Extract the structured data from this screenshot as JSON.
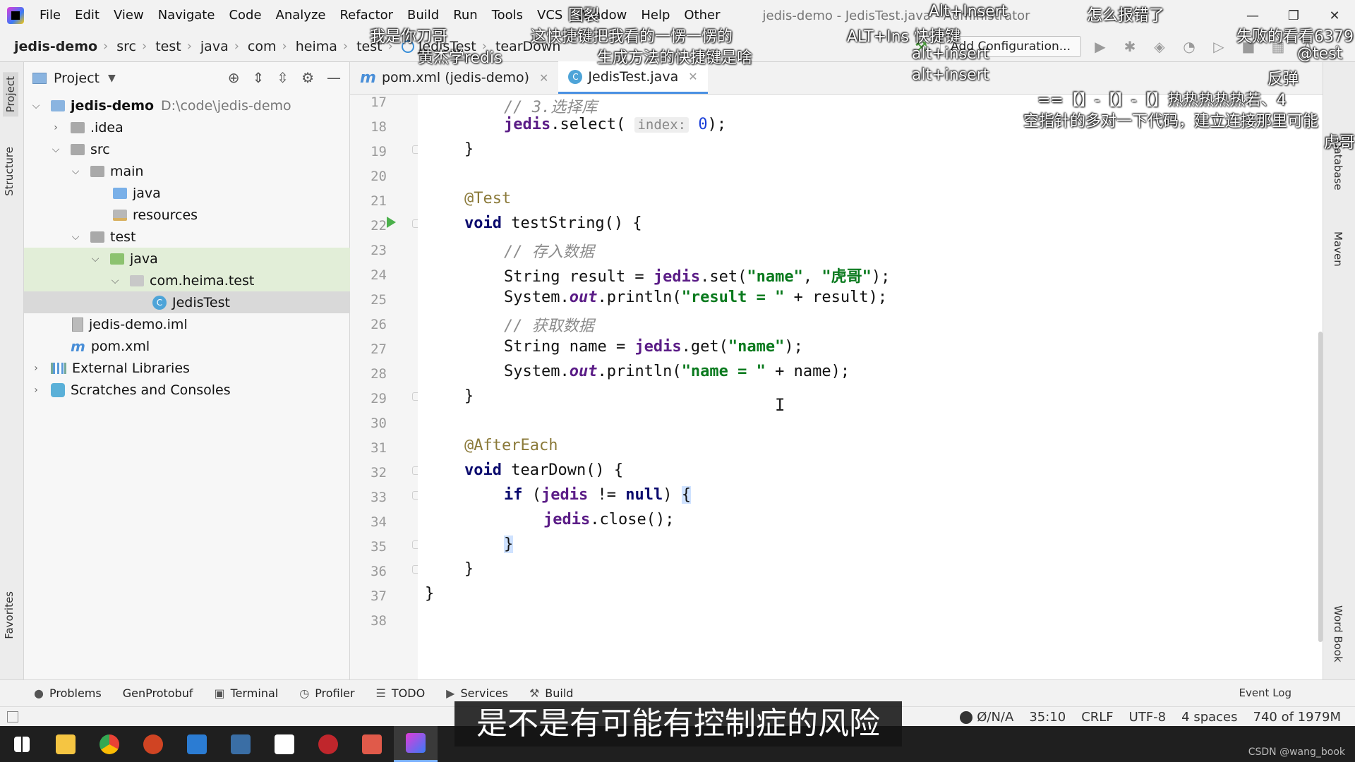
{
  "menubar": {
    "items": [
      "File",
      "Edit",
      "View",
      "Navigate",
      "Code",
      "Analyze",
      "Refactor",
      "Build",
      "Run",
      "Tools",
      "VCS",
      "Window",
      "Help",
      "Other"
    ],
    "title": "jedis-demo - JedisTest.java - Administrator"
  },
  "breadcrumb": {
    "items": [
      "jedis-demo",
      "src",
      "test",
      "java",
      "com",
      "heima",
      "test",
      "JedisTest",
      "tearDown"
    ]
  },
  "toolbar": {
    "add_configuration": "Add Configuration..."
  },
  "left_strip": {
    "project": "Project",
    "structure": "Structure",
    "favorites": "Favorites"
  },
  "project_panel": {
    "title": "Project",
    "root_name": "jedis-demo",
    "root_path": "D:\\code\\jedis-demo",
    "items": {
      "idea": ".idea",
      "src": "src",
      "main": "main",
      "main_java": "java",
      "resources": "resources",
      "test": "test",
      "test_java": "java",
      "package": "com.heima.test",
      "jedistest": "JedisTest",
      "iml": "jedis-demo.iml",
      "pom": "pom.xml",
      "external": "External Libraries",
      "scratches": "Scratches and Consoles"
    }
  },
  "editor": {
    "tabs": [
      {
        "label": "pom.xml (jedis-demo)",
        "active": false
      },
      {
        "label": "JedisTest.java",
        "active": true
      }
    ],
    "line_numbers": [
      "17",
      "18",
      "19",
      "20",
      "21",
      "22",
      "23",
      "24",
      "25",
      "26",
      "27",
      "28",
      "29",
      "30",
      "31",
      "32",
      "33",
      "34",
      "35",
      "36",
      "37",
      "38"
    ],
    "code": {
      "l17_comment": "// 3.选择库",
      "l18_obj": "jedis",
      "l18_call": ".select(",
      "l18_hint": "index:",
      "l18_num": "0",
      "l18_end": ");",
      "l19": "}",
      "l21": "@Test",
      "l22_kw": "void",
      "l22_rest": " testString() {",
      "l23": "// 存入数据",
      "l24_a": "String result = ",
      "l24_obj": "jedis",
      "l24_b": ".set(",
      "l24_s1": "\"name\"",
      "l24_c": ", ",
      "l24_s2": "\"虎哥\"",
      "l24_d": ");",
      "l25_a": "System.",
      "l25_out": "out",
      "l25_b": ".println(",
      "l25_s": "\"result = \"",
      "l25_c": " + result);",
      "l26": "// 获取数据",
      "l27_a": "String name = ",
      "l27_obj": "jedis",
      "l27_b": ".get(",
      "l27_s": "\"name\"",
      "l27_c": ");",
      "l28_a": "System.",
      "l28_out": "out",
      "l28_b": ".println(",
      "l28_s": "\"name = \"",
      "l28_c": " + name);",
      "l29": "}",
      "l31": "@AfterEach",
      "l32_kw": "void",
      "l32_rest": " tearDown() {",
      "l33_kw": "if",
      "l33_a": " (",
      "l33_obj": "jedis",
      "l33_b": " != ",
      "l33_null": "null",
      "l33_c": ") ",
      "l33_brace": "{",
      "l34_obj": "jedis",
      "l34_rest": ".close();",
      "l35": "}",
      "l36": "}",
      "l37": "}"
    }
  },
  "right_strip": {
    "database": "Database",
    "maven": "Maven",
    "wordbook": "Word Book"
  },
  "bottom_tools": [
    "Problems",
    "GenProtobuf",
    "Terminal",
    "Profiler",
    "TODO",
    "Services",
    "Build"
  ],
  "event_log": "Event Log",
  "status": {
    "vcs": "Ø/N/A",
    "position": "35:10",
    "line_sep": "CRLF",
    "encoding": "UTF-8",
    "indent": "4 spaces",
    "memory": "740 of 1979M"
  },
  "taskbar": {
    "watermark": "CSDN @wang_book"
  },
  "subtitle": "是不是有可能有控制症的风险",
  "danmaku": [
    "图裂",
    "Alt+Insert",
    "怎么报错了",
    "我是你刀哥",
    "这快捷键把我看的一愣一愣的",
    "ALT+Ins 快捷键",
    "失败的看看6379",
    "黄杰学redis",
    "生成方法的快捷键是啥",
    "alt+insert",
    "@test",
    "alt+insert",
    "反弹",
    "==【】-【】-【】热热热热热若、4",
    "空指针的多对一下代码，建立连接那里可能",
    "虎哥"
  ]
}
